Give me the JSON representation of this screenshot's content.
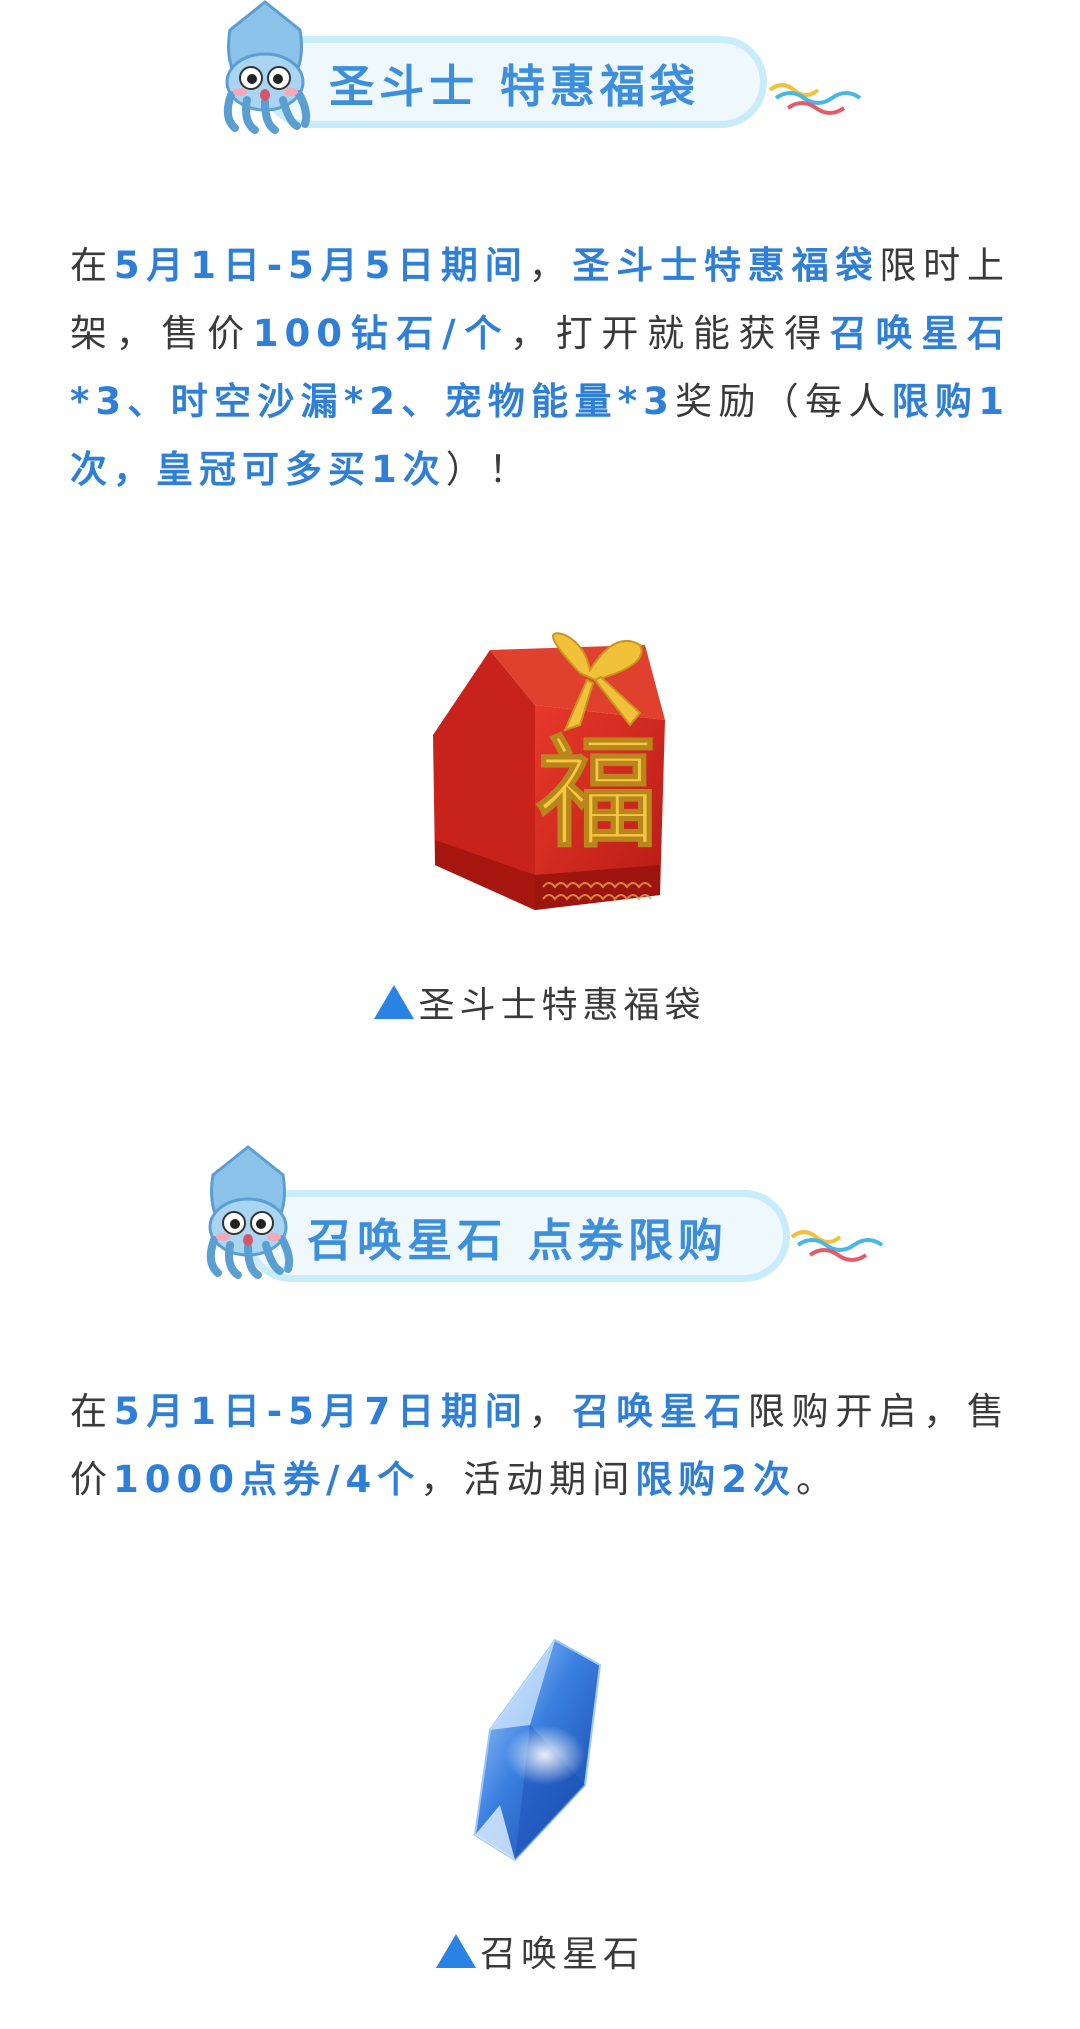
{
  "section1": {
    "title": "圣斗士 特惠福袋",
    "para": [
      {
        "t": "在",
        "hl": false
      },
      {
        "t": "5月1日-5月5日期间",
        "hl": true
      },
      {
        "t": "，",
        "hl": false
      },
      {
        "t": "圣斗士特惠福袋",
        "hl": true
      },
      {
        "t": "限时上架，售价",
        "hl": false
      },
      {
        "t": "100钻石/个",
        "hl": true
      },
      {
        "t": "，打开就能获得",
        "hl": false
      },
      {
        "t": "召唤星石*3、时空沙漏*2、宠物能量*3",
        "hl": true
      },
      {
        "t": "奖励（每人",
        "hl": false
      },
      {
        "t": "限购1次，皇冠可多买1次",
        "hl": true
      },
      {
        "t": "）！",
        "hl": false
      }
    ],
    "caption": "圣斗士特惠福袋",
    "image_glyph": "福"
  },
  "section2": {
    "title": "召唤星石 点券限购",
    "para": [
      {
        "t": "在",
        "hl": false
      },
      {
        "t": "5月1日-5月7日期间",
        "hl": true
      },
      {
        "t": "，",
        "hl": false
      },
      {
        "t": "召唤星石",
        "hl": true
      },
      {
        "t": "限购开启，售价",
        "hl": false
      },
      {
        "t": "1000点券/4个",
        "hl": true
      },
      {
        "t": "，活动期间",
        "hl": false
      },
      {
        "t": "限购2次",
        "hl": true
      },
      {
        "t": "。",
        "hl": false
      }
    ],
    "caption": "召唤星石"
  },
  "colors": {
    "accent": "#2f7fd6",
    "pill_bg": "#eef8fd",
    "pill_border": "#c9ecfa",
    "bag_red": "#d4241c",
    "gold": "#f2c13a"
  },
  "icons": {
    "mascot": "squid-mascot-icon",
    "triangle": "triangle-up-icon",
    "waves": "waves-icon"
  }
}
